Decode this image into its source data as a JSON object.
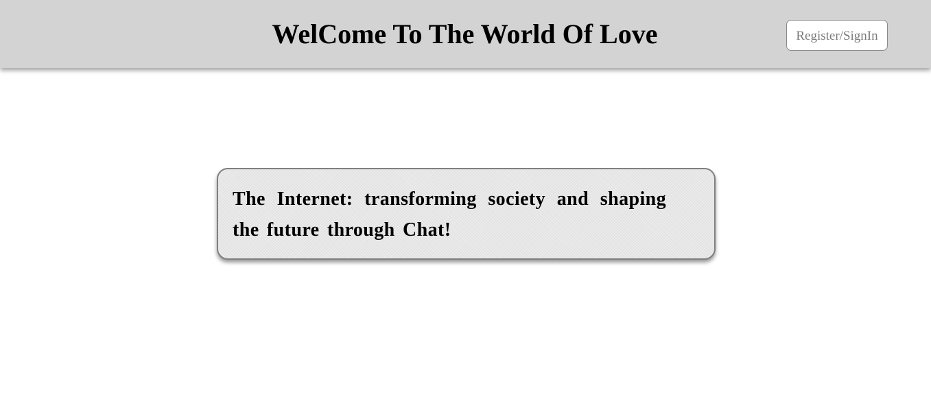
{
  "header": {
    "title": "WelCome To The World Of Love",
    "register_label": "Register/SignIn"
  },
  "main": {
    "tagline": "The Internet: transforming society and shaping the future through Chat!"
  },
  "colors": {
    "header_background": "#d3d3d3",
    "card_background": "#ececec",
    "card_border": "#808080",
    "button_text": "#7a7a7a"
  }
}
